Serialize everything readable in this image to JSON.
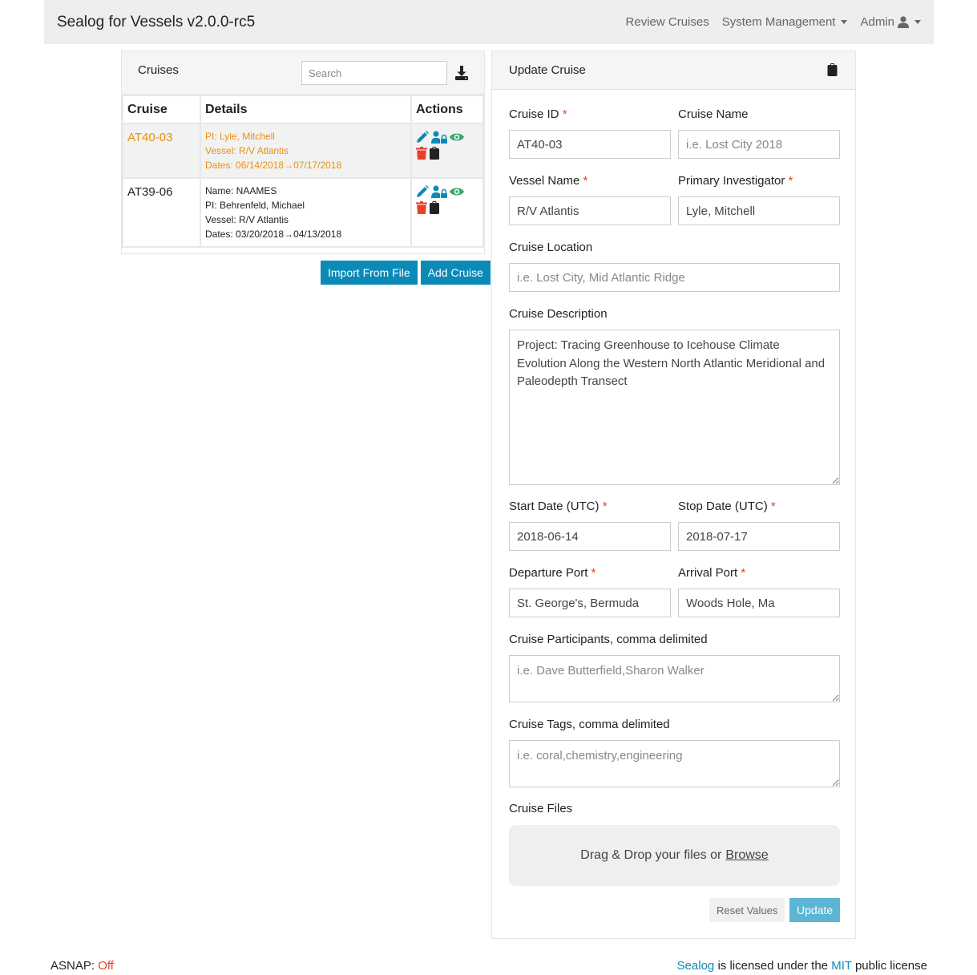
{
  "navbar": {
    "brand": "Sealog for Vessels v2.0.0-rc5",
    "items": [
      {
        "label": "Review Cruises",
        "dropdown": false
      },
      {
        "label": "System Management",
        "dropdown": true
      },
      {
        "label": "Admin",
        "dropdown": true,
        "icon": "user-icon"
      }
    ]
  },
  "cruises_panel": {
    "title": "Cruises",
    "search_placeholder": "Search",
    "download_icon": "download-icon",
    "columns": [
      "Cruise",
      "Details",
      "Actions"
    ],
    "rows": [
      {
        "id": "AT40-03",
        "active": true,
        "details": [
          "PI: Lyle, Mitchell",
          "Vessel: R/V Atlantis"
        ],
        "dates_label": "Dates: ",
        "start": "06/14/2018",
        "stop": "07/17/2018"
      },
      {
        "id": "AT39-06",
        "active": false,
        "details": [
          "Name: NAAMES",
          "PI: Behrenfeld, Michael",
          "Vessel: R/V Atlantis"
        ],
        "dates_label": "Dates: ",
        "start": "03/20/2018",
        "stop": "04/13/2018"
      }
    ],
    "import_button": "Import From File",
    "add_button": "Add Cruise"
  },
  "update_panel": {
    "title": "Update Cruise",
    "fields": {
      "cruise_id": {
        "label": "Cruise ID",
        "required": true,
        "value": "AT40-03",
        "placeholder": ""
      },
      "cruise_name": {
        "label": "Cruise Name",
        "required": false,
        "value": "",
        "placeholder": "i.e. Lost City 2018"
      },
      "vessel_name": {
        "label": "Vessel Name",
        "required": true,
        "value": "R/V Atlantis",
        "placeholder": ""
      },
      "pi": {
        "label": "Primary Investigator",
        "required": true,
        "value": "Lyle, Mitchell",
        "placeholder": ""
      },
      "location": {
        "label": "Cruise Location",
        "required": false,
        "value": "",
        "placeholder": "i.e. Lost City, Mid Atlantic Ridge"
      },
      "description": {
        "label": "Cruise Description",
        "required": false,
        "value": "Project: Tracing Greenhouse to Icehouse Climate Evolution Along the Western North Atlantic Meridional and Paleodepth Transect",
        "placeholder": ""
      },
      "start_date": {
        "label": "Start Date (UTC)",
        "required": true,
        "value": "2018-06-14",
        "placeholder": ""
      },
      "stop_date": {
        "label": "Stop Date (UTC)",
        "required": true,
        "value": "2018-07-17",
        "placeholder": ""
      },
      "departure_port": {
        "label": "Departure Port",
        "required": true,
        "value": "St. George's, Bermuda",
        "placeholder": ""
      },
      "arrival_port": {
        "label": "Arrival Port",
        "required": true,
        "value": "Woods Hole, Ma",
        "placeholder": ""
      },
      "participants": {
        "label": "Cruise Participants, comma delimited",
        "required": false,
        "value": "",
        "placeholder": "i.e. Dave Butterfield,Sharon Walker"
      },
      "tags": {
        "label": "Cruise Tags, comma delimited",
        "required": false,
        "value": "",
        "placeholder": "i.e. coral,chemistry,engineering"
      },
      "files": {
        "label": "Cruise Files"
      }
    },
    "dropzone_text": "Drag & Drop your files or",
    "browse_label": "Browse",
    "reset_button": "Reset Values",
    "update_button": "Update",
    "required_mark": "*"
  },
  "footer": {
    "asnap_label": "ASNAP:",
    "asnap_value": "Off",
    "license_link1": "Sealog",
    "license_text1": "is licensed under the",
    "license_link2": "MIT",
    "license_text2": "public license"
  },
  "colors": {
    "accent": "#0b8ab8",
    "active_row": "#e8900f",
    "danger": "#e8402a",
    "success": "#3aa66a"
  }
}
